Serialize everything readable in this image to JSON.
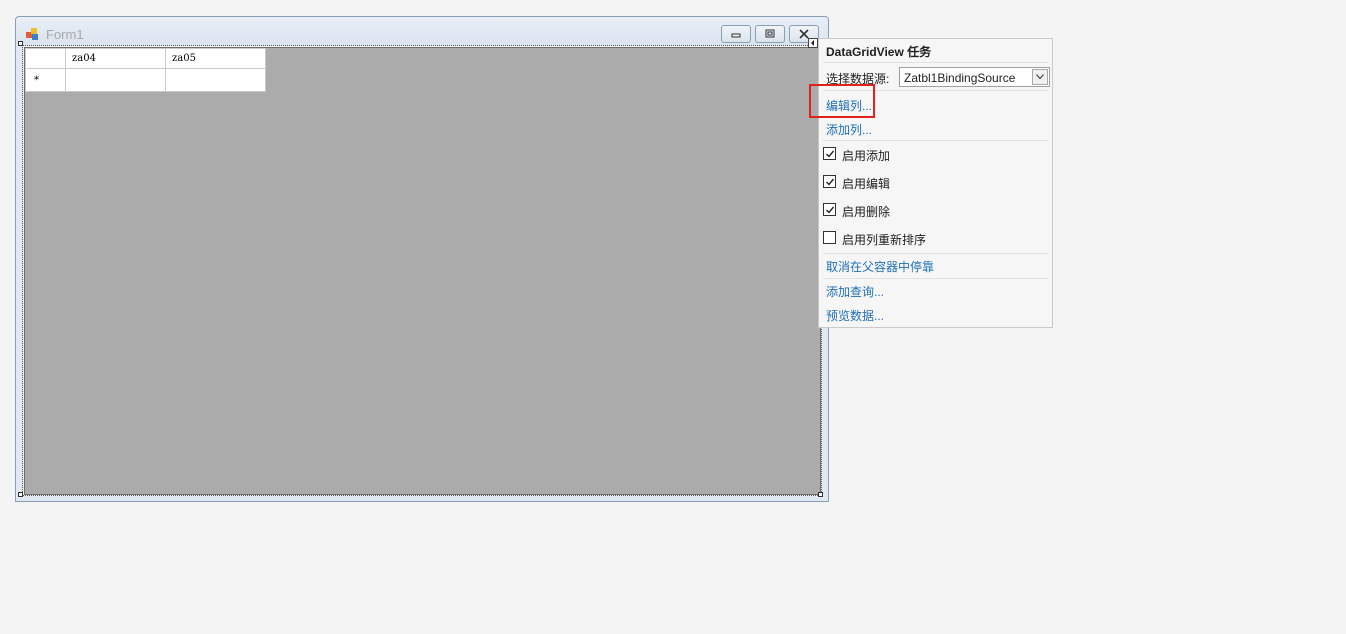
{
  "form": {
    "title": "Form1"
  },
  "grid": {
    "columns": [
      "za04",
      "za05"
    ],
    "new_row_marker": "*"
  },
  "task_panel": {
    "header": "DataGridView 任务",
    "datasource_label": "选择数据源:",
    "datasource_value": "Zatbl1BindingSource",
    "links": {
      "edit_columns": "编辑列...",
      "add_column": "添加列...",
      "undock": "取消在父容器中停靠",
      "add_query": "添加查询...",
      "preview_data": "预览数据..."
    },
    "checkboxes": [
      {
        "label": "启用添加",
        "checked": true
      },
      {
        "label": "启用编辑",
        "checked": true
      },
      {
        "label": "启用删除",
        "checked": true
      },
      {
        "label": "启用列重新排序",
        "checked": false
      }
    ]
  },
  "colors": {
    "link": "#1e6fb8",
    "highlight": "#e0221e",
    "grid_background": "#ababab"
  }
}
